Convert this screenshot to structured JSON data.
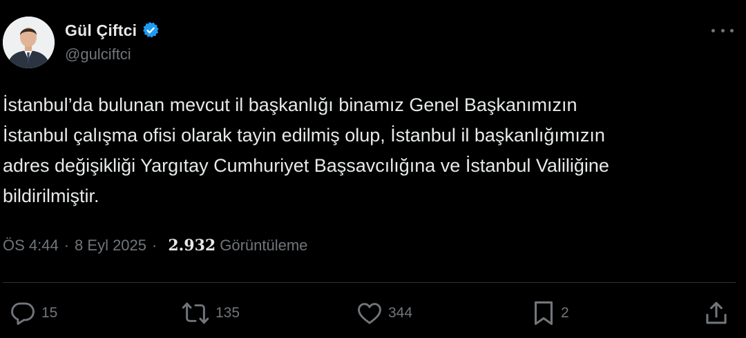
{
  "author": {
    "display_name": "Gül Çiftci",
    "handle": "@gulciftci"
  },
  "tweet": {
    "text": "İstanbul’da bulunan mevcut il başkanlığı binamız Genel Başkanımızın\nİstanbul çalışma ofisi olarak tayin edilmiş olup, İstanbul il başkanlığımızın\nadres değişikliği Yargıtay Cumhuriyet Başsavcılığına ve İstanbul Valiliğine\nbildirilmiştir."
  },
  "meta": {
    "time": "ÖS 4:44",
    "separator": "·",
    "date": "8 Eyl 2025",
    "views_count": "2.932",
    "views_label": "Görüntüleme"
  },
  "actions": {
    "replies": "15",
    "reposts": "135",
    "likes": "344",
    "bookmarks": "2"
  },
  "icons": {
    "verified": "verified-badge-icon",
    "more": "more-options-icon",
    "reply": "reply-icon",
    "repost": "repost-icon",
    "like": "heart-icon",
    "bookmark": "bookmark-icon",
    "share": "share-icon"
  },
  "colors": {
    "background": "#000000",
    "text_primary": "#e7e9ea",
    "text_secondary": "#71767b",
    "verified_blue": "#1d9bf0",
    "divider": "#2f3336"
  }
}
